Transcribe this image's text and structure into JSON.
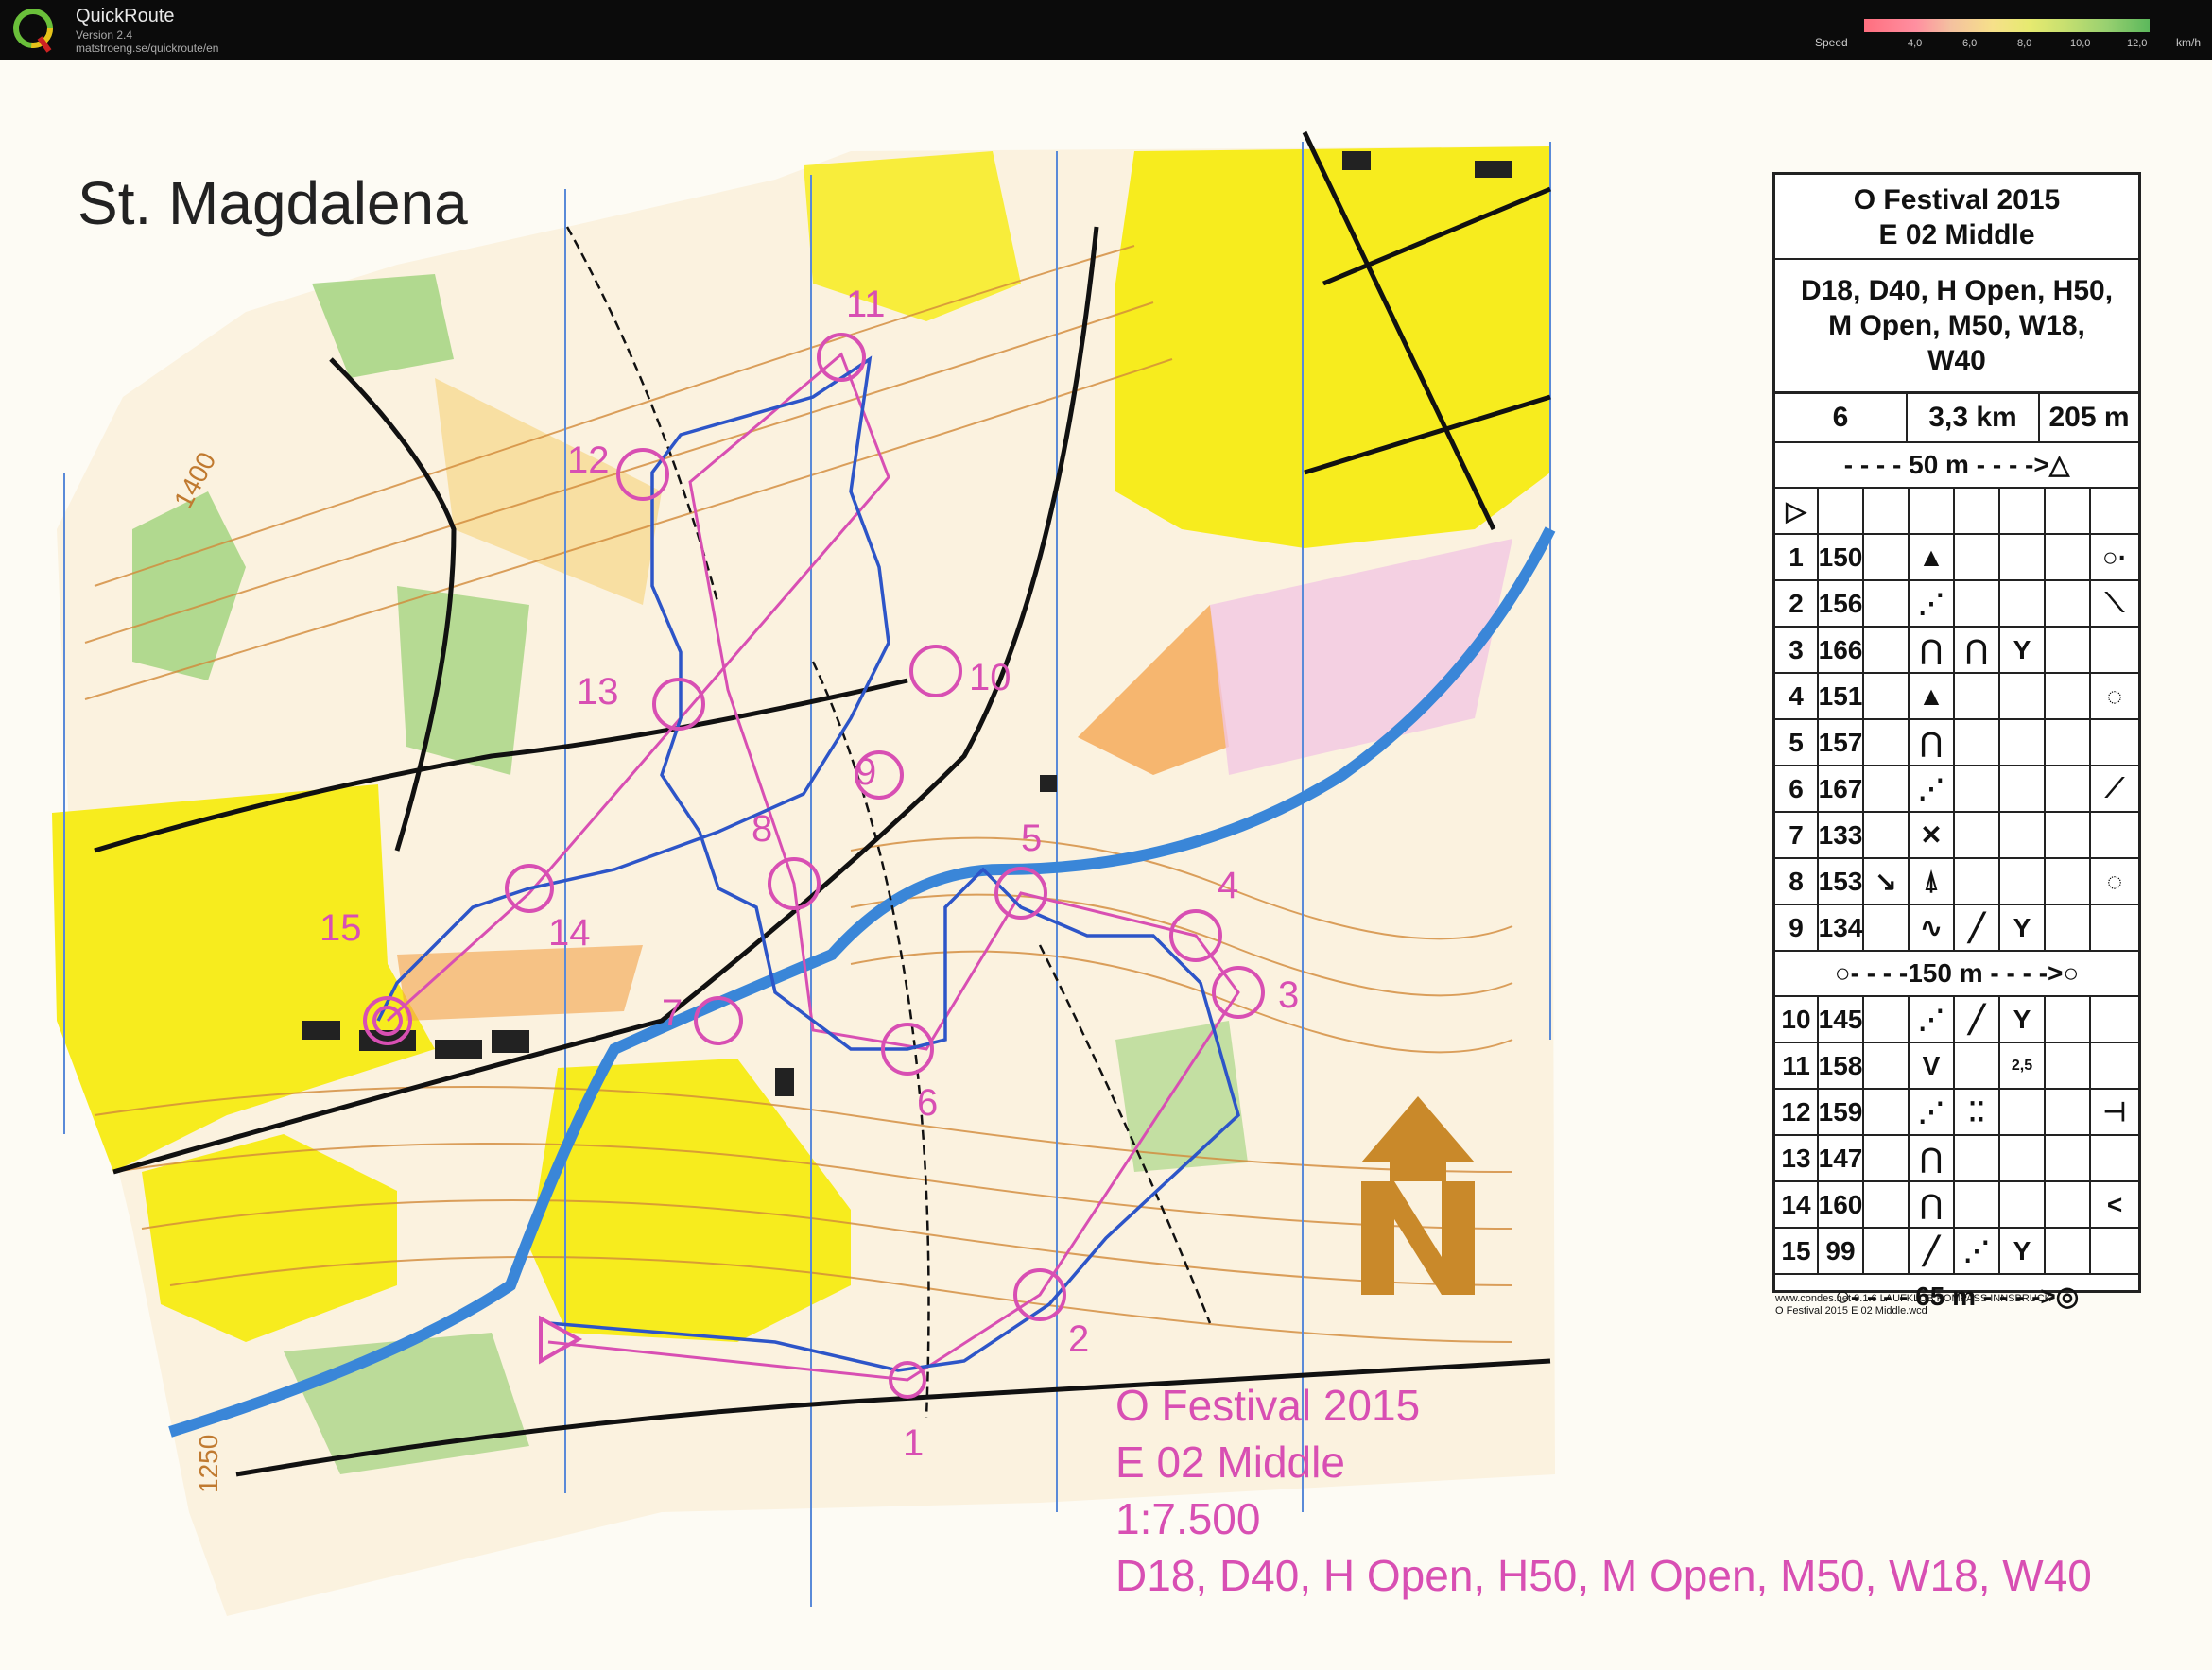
{
  "app": {
    "title": "QuickRoute",
    "version": "Version 2.4",
    "url": "matstroeng.se/quickroute/en",
    "speed_label": "Speed",
    "speed_ticks": [
      "4,0",
      "6,0",
      "8,0",
      "10,0",
      "12,0"
    ],
    "speed_unit": "km/h"
  },
  "map": {
    "title": "St. Magdalena",
    "event_lines": [
      "O Festival 2015",
      "E 02 Middle",
      "1:7.500",
      "D18, D40, H Open, H50, M Open, M50, W18, W40"
    ],
    "contour_labels": [
      "1400",
      "1250"
    ],
    "control_numbers": [
      "1",
      "2",
      "3",
      "4",
      "5",
      "6",
      "7",
      "8",
      "9",
      "10",
      "11",
      "12",
      "13",
      "14",
      "15"
    ],
    "colors": {
      "forest_yellow": "#f7ec1e",
      "green": "#9fd27a",
      "contour": "#d28a3a",
      "course": "#d84fb3",
      "route": "#2d55c8",
      "water": "#3a86d8"
    }
  },
  "control_description": {
    "event": [
      "O Festival 2015",
      "E 02 Middle"
    ],
    "classes": [
      "D18, D40, H Open, H50,",
      "M Open, M50, W18,",
      "W40"
    ],
    "controls_count": "6",
    "length": "3,3 km",
    "climb": "205 m",
    "marked_route": "- - - -  50 m  - - - ->△",
    "start_symbol": "▷",
    "rows": [
      {
        "num": "1",
        "code": "150",
        "s1": "",
        "s2": "▲",
        "s3": "",
        "s4": "",
        "s5": "",
        "s6": "○·"
      },
      {
        "num": "2",
        "code": "156",
        "s1": "",
        "s2": "⋰",
        "s3": "",
        "s4": "",
        "s5": "",
        "s6": "⟍"
      },
      {
        "num": "3",
        "code": "166",
        "s1": "",
        "s2": "⋂",
        "s3": "⋂",
        "s4": "Y",
        "s5": "",
        "s6": ""
      },
      {
        "num": "4",
        "code": "151",
        "s1": "",
        "s2": "▲",
        "s3": "",
        "s4": "",
        "s5": "",
        "s6": "◌"
      },
      {
        "num": "5",
        "code": "157",
        "s1": "",
        "s2": "⋂",
        "s3": "",
        "s4": "",
        "s5": "",
        "s6": ""
      },
      {
        "num": "6",
        "code": "167",
        "s1": "",
        "s2": "⋰",
        "s3": "",
        "s4": "",
        "s5": "",
        "s6": "⟋"
      },
      {
        "num": "7",
        "code": "133",
        "s1": "",
        "s2": "✕",
        "s3": "",
        "s4": "",
        "s5": "",
        "s6": ""
      },
      {
        "num": "8",
        "code": "153",
        "s1": "↘",
        "s2": "⍋",
        "s3": "",
        "s4": "",
        "s5": "",
        "s6": "◌"
      },
      {
        "num": "9",
        "code": "134",
        "s1": "",
        "s2": "∿",
        "s3": "╱",
        "s4": "Y",
        "s5": "",
        "s6": ""
      }
    ],
    "tape_route": "○- - - -150 m - - - ->○",
    "rows2": [
      {
        "num": "10",
        "code": "145",
        "s1": "",
        "s2": "⋰",
        "s3": "╱",
        "s4": "Y",
        "s5": "",
        "s6": ""
      },
      {
        "num": "11",
        "code": "158",
        "s1": "",
        "s2": "V",
        "s3": "",
        "s4": "2,5",
        "s5": "",
        "s6": ""
      },
      {
        "num": "12",
        "code": "159",
        "s1": "",
        "s2": "⋰",
        "s3": "⁚⁚",
        "s4": "",
        "s5": "",
        "s6": "⊣"
      },
      {
        "num": "13",
        "code": "147",
        "s1": "",
        "s2": "⋂",
        "s3": "",
        "s4": "",
        "s5": "",
        "s6": ""
      },
      {
        "num": "14",
        "code": "160",
        "s1": "",
        "s2": "⋂",
        "s3": "",
        "s4": "",
        "s5": "",
        "s6": "<"
      },
      {
        "num": "15",
        "code": "99",
        "s1": "",
        "s2": "╱",
        "s3": "⋰",
        "s4": "Y",
        "s5": "",
        "s6": ""
      }
    ],
    "finish": "○- - - - 65 m - - - ->◎",
    "footer": [
      "www.condes.net 9.1.6 LAUFKLUB KOMPASS INNSBRUCK",
      "O Festival 2015 E 02 Middle.wcd"
    ]
  }
}
